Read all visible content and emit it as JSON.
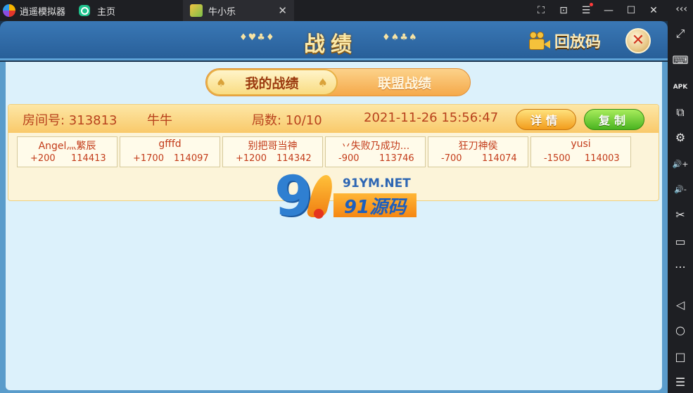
{
  "emulator": {
    "app_name": "逍遥模拟器",
    "home_tab": "主页",
    "game_tab": "牛小乐",
    "tab_close": "✕",
    "controls": [
      "⛶",
      "⊡",
      "☰",
      "—",
      "☐",
      "✕"
    ],
    "collapse": "‹‹‹"
  },
  "toolbar": {
    "items": [
      "⤢",
      "⌨",
      "APK",
      "⧉",
      "⚙",
      "🔊+",
      "🔊-",
      "✂",
      "▭",
      "⋯",
      "◁",
      "○",
      "□",
      "☰"
    ]
  },
  "header": {
    "suits_left": "♦♥♣♦",
    "title": "战绩",
    "suits_right": "♦♠♣♠",
    "replay_label": "回放码",
    "close_label": "✕"
  },
  "tabs": {
    "mine": "我的战绩",
    "alliance": "联盟战绩",
    "spade": "♠"
  },
  "record": {
    "room": "房间号: 313813",
    "game": "牛牛",
    "rounds": "局数: 10/10",
    "time": "2021-11-26 15:56:47",
    "detail_label": "详情",
    "copy_label": "复制",
    "players": [
      {
        "name": "Angel灬繁辰",
        "score": "+200",
        "id": "114413"
      },
      {
        "name": "gfffd",
        "score": "+1700",
        "id": "114097"
      },
      {
        "name": "别把哥当神",
        "score": "+1200",
        "id": "114342"
      },
      {
        "name": "丷失败乃成功...",
        "score": "-900",
        "id": "113746"
      },
      {
        "name": "狂刀神侯",
        "score": "-700",
        "id": "114074"
      },
      {
        "name": "yusi",
        "score": "-1500",
        "id": "114003"
      }
    ]
  },
  "watermark": {
    "nine": "9",
    "url": "91YM.NET",
    "brand": "91源码"
  }
}
